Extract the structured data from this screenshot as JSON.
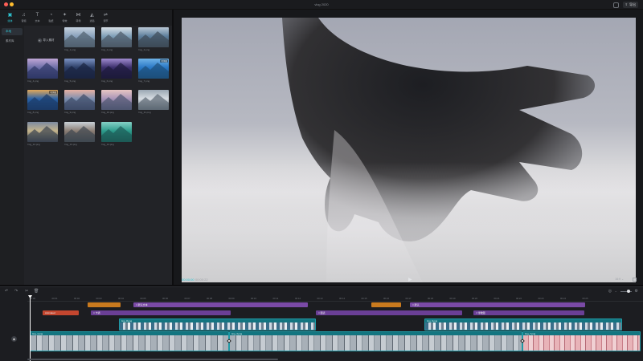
{
  "window": {
    "title": "vlog 2020",
    "export_label": "导出"
  },
  "top_tabs": [
    {
      "label": "媒体",
      "icon": "media-icon",
      "glyph": "▣",
      "active": true
    },
    {
      "label": "音频",
      "icon": "audio-icon",
      "glyph": "♫",
      "active": false
    },
    {
      "label": "文本",
      "icon": "text-icon",
      "glyph": "T",
      "active": false
    },
    {
      "label": "贴纸",
      "icon": "sticker-icon",
      "glyph": "◔",
      "active": false
    },
    {
      "label": "特效",
      "icon": "effects-icon",
      "glyph": "✦",
      "active": false
    },
    {
      "label": "转场",
      "icon": "transition-icon",
      "glyph": "⋈",
      "active": false
    },
    {
      "label": "滤镜",
      "icon": "filter-icon",
      "glyph": "◭",
      "active": false
    },
    {
      "label": "调节",
      "icon": "adjust-icon",
      "glyph": "⇌",
      "active": false
    }
  ],
  "side_nav": [
    {
      "label": "本地",
      "active": true
    },
    {
      "label": "素材库",
      "active": false
    }
  ],
  "media": {
    "import_label": "导入素材",
    "thumbs": [
      {
        "caption": "Img_1.png",
        "colors": [
          "#8aa2bd",
          "#c7d3df",
          "#50606e"
        ]
      },
      {
        "caption": "Img_2.png",
        "colors": [
          "#7f9fb8",
          "#d8e0e6",
          "#4b5966"
        ]
      },
      {
        "caption": "Img_3.png",
        "colors": [
          "#5d7f9c",
          "#b9c8d6",
          "#3d4a57"
        ]
      },
      {
        "caption": "Img_4.png",
        "colors": [
          "#6d6fa8",
          "#c0a7d6",
          "#2f3766"
        ]
      },
      {
        "caption": "Img_5.png",
        "colors": [
          "#2c3e66",
          "#7c93c4",
          "#1a2340"
        ]
      },
      {
        "caption": "Img_6.png",
        "colors": [
          "#3b2f6b",
          "#a08ad0",
          "#1d1a3a"
        ]
      },
      {
        "caption": "Img_7.png",
        "colors": [
          "#2a78c5",
          "#6fb3e8",
          "#1c4f7a"
        ],
        "added": "已添加"
      },
      {
        "caption": "Img_8.png",
        "colors": [
          "#2a62a8",
          "#e0a75a",
          "#1b3a66"
        ],
        "added": "已添加"
      },
      {
        "caption": "Img_9.png",
        "colors": [
          "#7d8fb0",
          "#e7b0a2",
          "#3d4a66"
        ]
      },
      {
        "caption": "Img_10.png",
        "colors": [
          "#a894b8",
          "#e8c6c3",
          "#4e5670"
        ]
      },
      {
        "caption": "Img_11.png",
        "colors": [
          "#d7dde3",
          "#9aa7b3",
          "#5d6873"
        ]
      },
      {
        "caption": "Img_12.png",
        "colors": [
          "#c5b58c",
          "#7d8aa0",
          "#39424f"
        ]
      },
      {
        "caption": "Img_13.png",
        "colors": [
          "#8b7d73",
          "#c9d1d8",
          "#3f4750"
        ]
      },
      {
        "caption": "Img_14.png",
        "colors": [
          "#2d9c8c",
          "#86d1c6",
          "#1d5a55"
        ]
      }
    ]
  },
  "preview": {
    "current_time": "00:00:00",
    "total_time": "00:00:22",
    "ratio_label": "16:9",
    "ratio_caret": "⌄"
  },
  "timeline": {
    "ticks": [
      "00:00",
      "00:01",
      "00:02",
      "00:03",
      "00:04",
      "00:05",
      "00:06",
      "00:07",
      "00:08",
      "00:09",
      "00:10",
      "00:11",
      "00:12",
      "00:13",
      "00:14",
      "00:15",
      "00:16",
      "00:17",
      "00:18",
      "00:19",
      "00:20",
      "00:21",
      "00:22",
      "00:23",
      "00:24",
      "00:25"
    ],
    "text_clips": [
      {
        "label": "",
        "style": "orange"
      },
      {
        "label": "□ 默认文本",
        "style": "purple"
      },
      {
        "label": "",
        "style": "orange"
      },
      {
        "label": "□ 默认",
        "style": "purple"
      },
      {
        "label": "Animated",
        "style": "red"
      },
      {
        "label": "□ 卡通",
        "style": "purple2"
      },
      {
        "label": "□ 图表",
        "style": "purple2"
      },
      {
        "label": "□ 零散图",
        "style": "purple2"
      }
    ],
    "video_clips": [
      {
        "label": "Img_8.png",
        "style": "mountain"
      },
      {
        "label": "Img_9.png",
        "style": "mountain"
      },
      {
        "label": "Img_1.png",
        "style": "main"
      },
      {
        "label": "Img_3.png",
        "style": "main"
      },
      {
        "label": "Img_7.png",
        "style": "pink"
      }
    ]
  }
}
